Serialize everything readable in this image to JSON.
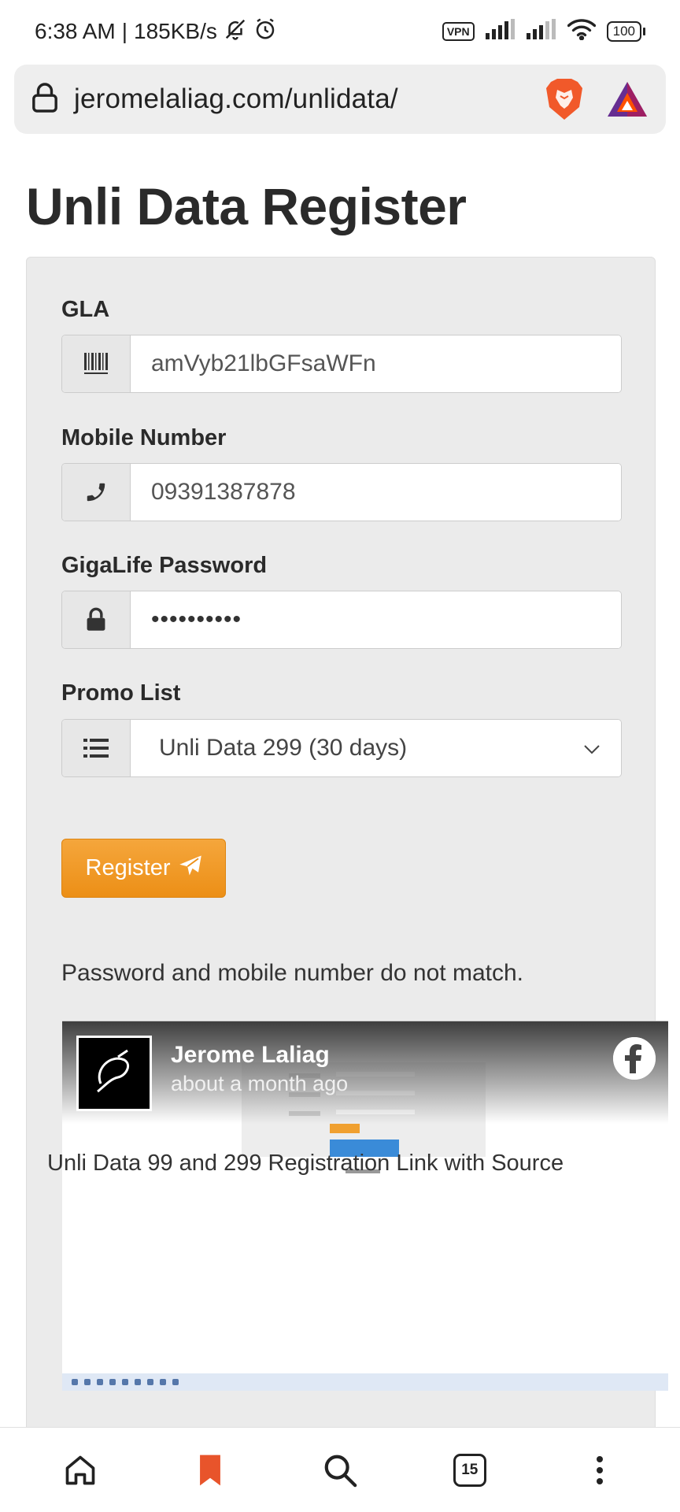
{
  "status_bar": {
    "time": "6:38 AM",
    "separator": "|",
    "speed": "185KB/s",
    "vpn": "VPN",
    "battery": "100"
  },
  "browser": {
    "url": "jeromelaliag.com/unlidata/",
    "icons": [
      "lock-icon",
      "brave-lion-icon",
      "bat-rewards-icon"
    ]
  },
  "page": {
    "title": "Unli Data Register"
  },
  "form": {
    "gla": {
      "label": "GLA",
      "value": "amVyb21lbGFsaWFn",
      "icon": "barcode-icon"
    },
    "mobile": {
      "label": "Mobile Number",
      "value": "09391387878",
      "icon": "phone-icon"
    },
    "password": {
      "label": "GigaLife Password",
      "value": "••••••••••",
      "icon": "lock-icon"
    },
    "promo": {
      "label": "Promo List",
      "selected": "Unli Data 299 (30 days)",
      "icon": "list-icon"
    },
    "register_label": "Register",
    "message": "Password and mobile number do not match."
  },
  "embed": {
    "author": "Jerome Laliag",
    "time": "about a month ago",
    "caption": "Unli Data 99 and 299 Registration Link with Source"
  },
  "bottom_nav": {
    "tab_count": "15",
    "icons": [
      "home-icon",
      "bookmark-icon",
      "search-icon",
      "tabs-icon",
      "more-icon"
    ],
    "accent": "#e8542b"
  },
  "colors": {
    "button": "#f09a24",
    "card": "#ebebeb"
  }
}
